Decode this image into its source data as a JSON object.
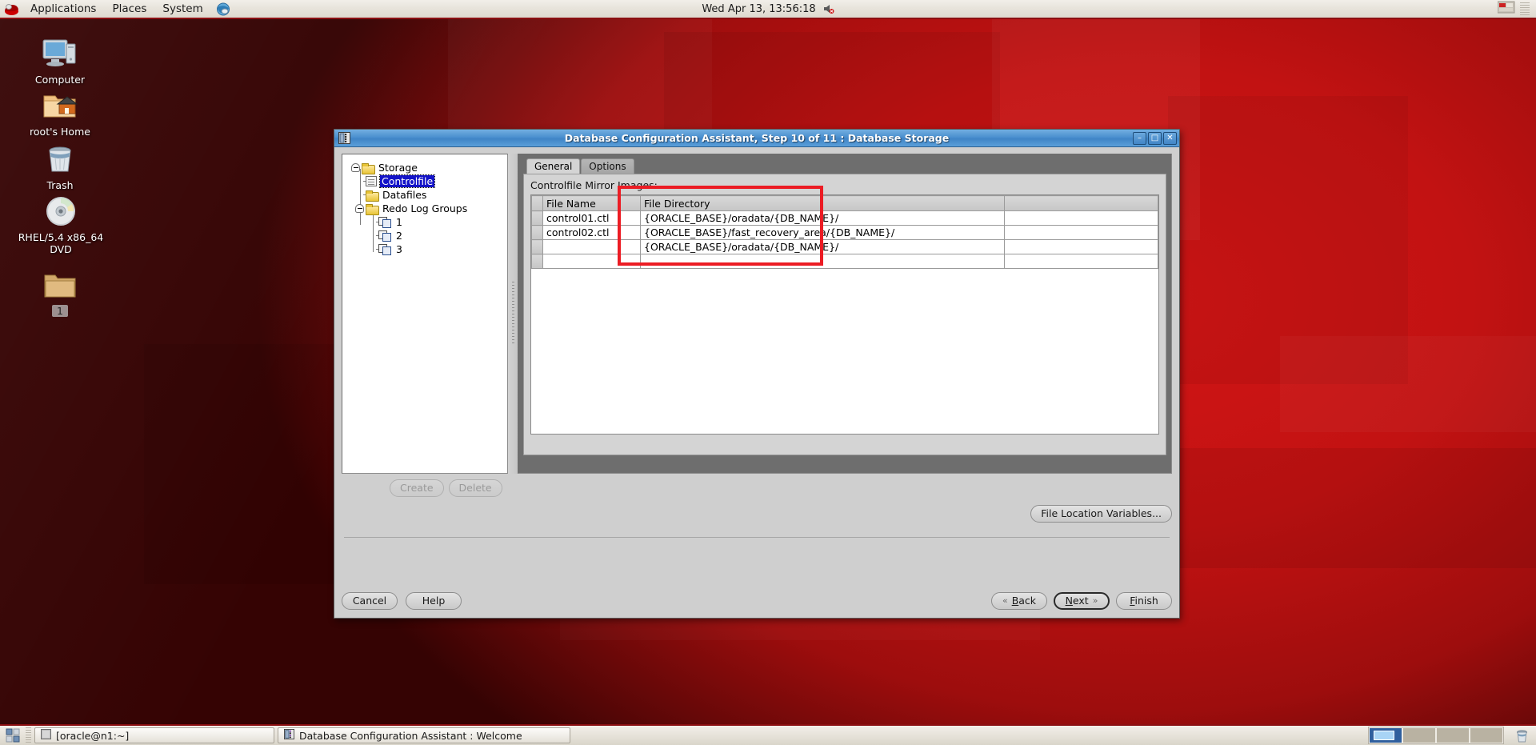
{
  "desktop": {
    "icons": [
      {
        "label": "Computer",
        "icon": "computer-icon"
      },
      {
        "label": "root's Home",
        "icon": "home-folder-icon"
      },
      {
        "label": "Trash",
        "icon": "trash-icon"
      },
      {
        "label": "RHEL/5.4 x86_64 DVD",
        "icon": "cd-rom-icon"
      },
      {
        "label": "1",
        "icon": "folder-icon"
      }
    ]
  },
  "top_panel": {
    "menus": [
      "Applications",
      "Places",
      "System"
    ],
    "logo_icon": "redhat-logo-icon",
    "browser_icon": "web-browser-icon",
    "clock": "Wed Apr 13, 13:56:18",
    "volume_icon": "volume-muted-icon",
    "tray_icon": "tray-applet-icon"
  },
  "bottom_panel": {
    "show_desktop_icon": "show-desktop-icon",
    "tasks": [
      {
        "label": "[oracle@n1:~]",
        "icon": "terminal-icon"
      },
      {
        "label": "Database Configuration Assistant : Welcome",
        "icon": "dbca-icon"
      }
    ],
    "workspaces": [
      "1",
      "2",
      "3",
      "4"
    ],
    "active_workspace": 0,
    "trash_icon": "trash-applet-icon"
  },
  "window": {
    "title": "Database Configuration Assistant, Step 10 of 11 : Database Storage",
    "app_icon": "dbca-icon",
    "controls": {
      "minimize": "–",
      "maximize": "□",
      "close": "✕"
    }
  },
  "tree": {
    "nodes": [
      {
        "label": "Storage",
        "icon": "folder-icon",
        "expander": "minus",
        "depth": 0,
        "selected": false
      },
      {
        "label": "Controlfile",
        "icon": "controlfile-icon",
        "expander": "none",
        "depth": 1,
        "selected": true
      },
      {
        "label": "Datafiles",
        "icon": "folder-icon",
        "expander": "none",
        "depth": 1,
        "selected": false
      },
      {
        "label": "Redo Log Groups",
        "icon": "folder-icon",
        "expander": "minus",
        "depth": 1,
        "selected": false
      },
      {
        "label": "1",
        "icon": "redolog-icon",
        "expander": "none",
        "depth": 2,
        "selected": false
      },
      {
        "label": "2",
        "icon": "redolog-icon",
        "expander": "none",
        "depth": 2,
        "selected": false
      },
      {
        "label": "3",
        "icon": "redolog-icon",
        "expander": "none",
        "depth": 2,
        "selected": false
      }
    ]
  },
  "tabs": [
    {
      "label": "General",
      "active": true
    },
    {
      "label": "Options",
      "active": false
    }
  ],
  "panel": {
    "mirror_label": "Controlfile Mirror Images:",
    "columns": [
      "File Name",
      "File Directory",
      ""
    ],
    "rows": [
      {
        "file_name": "control01.ctl",
        "file_directory": "{ORACLE_BASE}/oradata/{DB_NAME}/"
      },
      {
        "file_name": "control02.ctl",
        "file_directory": "{ORACLE_BASE}/fast_recovery_area/{DB_NAME}/"
      },
      {
        "file_name": "",
        "file_directory": "{ORACLE_BASE}/oradata/{DB_NAME}/"
      },
      {
        "file_name": "",
        "file_directory": ""
      }
    ]
  },
  "annotation": {
    "color": "#ec1c24",
    "target": "file-directory-column"
  },
  "buttons": {
    "create": "Create",
    "delete": "Delete",
    "file_location_variables": "File Location Variables...",
    "cancel": "Cancel",
    "help": "Help",
    "back": "Back",
    "next": "Next",
    "finish": "Finish",
    "back_chevron": "«",
    "next_chevron": "»"
  }
}
